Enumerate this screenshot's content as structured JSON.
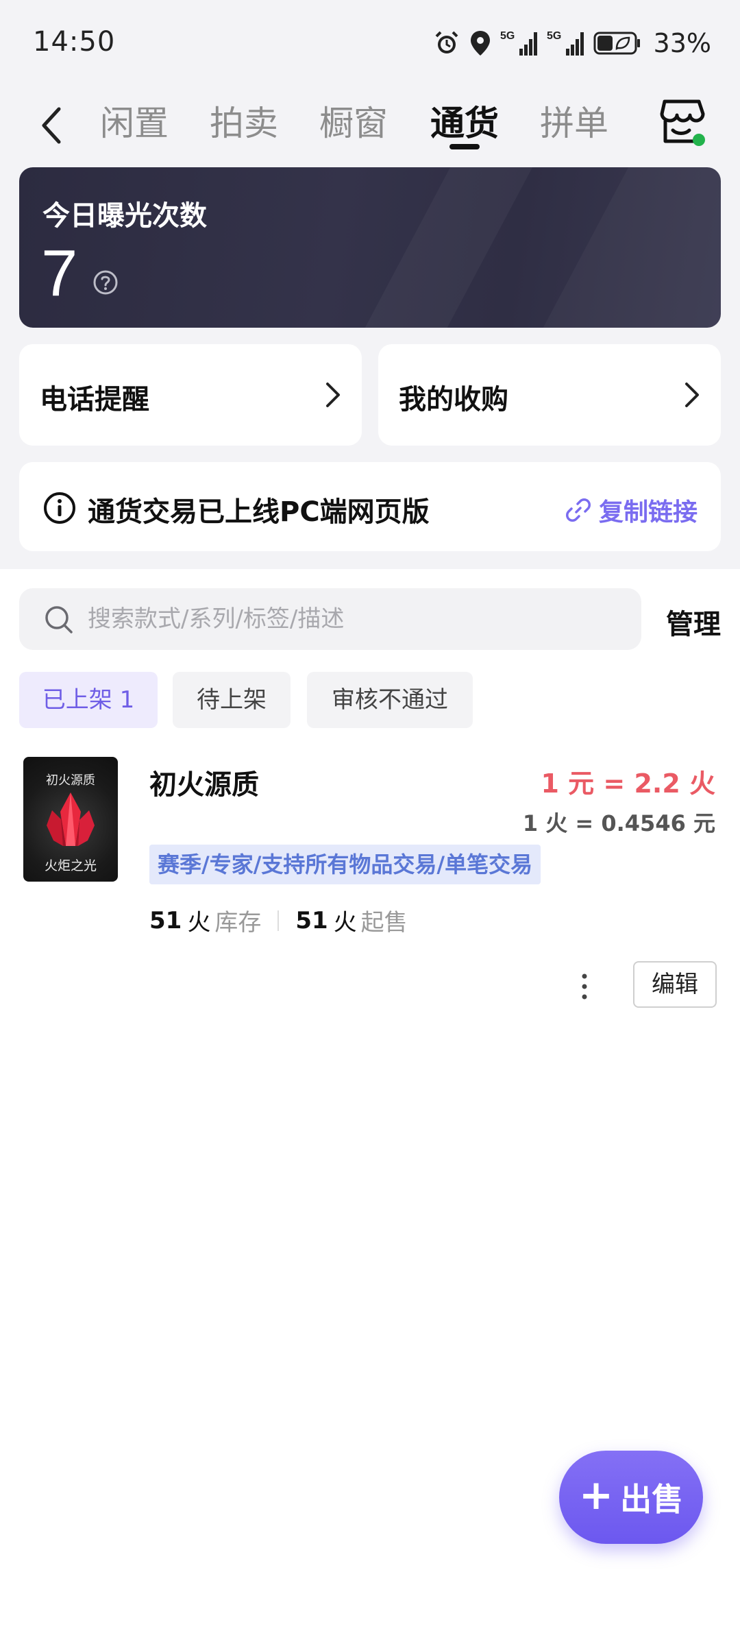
{
  "status_bar": {
    "time": "14:50",
    "battery_percent": "33%",
    "signal_1": "5G",
    "signal_2": "5G"
  },
  "nav": {
    "tabs": [
      {
        "label": "闲置",
        "active": false
      },
      {
        "label": "拍卖",
        "active": false
      },
      {
        "label": "橱窗",
        "active": false
      },
      {
        "label": "通货",
        "active": true
      },
      {
        "label": "拼单",
        "active": false
      }
    ],
    "back_icon": "chevron-left-icon",
    "shop_icon": "shop-icon",
    "shop_status_color": "#22b24c"
  },
  "exposure": {
    "title": "今日曝光次数",
    "count": "7",
    "help_icon": "question-circle-icon"
  },
  "entries": [
    {
      "label": "电话提醒"
    },
    {
      "label": "我的收购"
    }
  ],
  "notice": {
    "text": "通货交易已上线PC端网页版",
    "copy_label": "复制链接",
    "accent": "#7a6cf0"
  },
  "search": {
    "placeholder": "搜索款式/系列/标签/描述",
    "value": ""
  },
  "manage_label": "管理",
  "filters": [
    {
      "label": "已上架 1",
      "active": true
    },
    {
      "label": "待上架",
      "active": false
    },
    {
      "label": "审核不通过",
      "active": false
    }
  ],
  "listing": {
    "thumb_top": "初火源质",
    "thumb_bottom": "火炬之光",
    "name": "初火源质",
    "rate": "1 元 = 2.2 火",
    "rate_inverse": "1 火 = 0.4546 元",
    "tags": "赛季/专家/支持所有物品交易/单笔交易",
    "stock_num": "51",
    "stock_unit": "火",
    "stock_label": "库存",
    "min_num": "51",
    "min_unit": "火",
    "min_label": "起售",
    "edit_label": "编辑",
    "rate_color": "#ea5a64"
  },
  "fab": {
    "plus": "+",
    "label": "出售",
    "color": "#7563f2"
  }
}
